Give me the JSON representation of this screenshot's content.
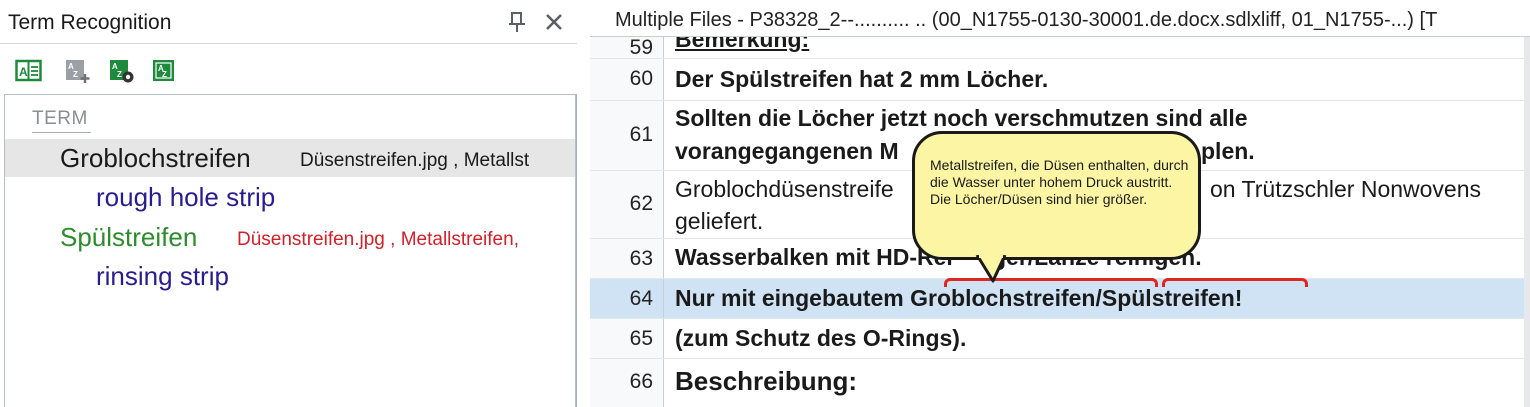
{
  "term_recognition": {
    "title": "Term Recognition",
    "column_header": "TERM",
    "toolbar": {
      "btn1_icon": "view-term-icon",
      "btn2_icon": "add-term-icon",
      "btn3_icon": "term-settings-icon",
      "btn4_icon": "termbase-search-icon"
    },
    "terms": [
      {
        "source": "Groblochstreifen",
        "source_color": "#1a1a1a",
        "files": "Düsenstreifen.jpg , Metallst",
        "files_color": "#1a1a1a",
        "target": "rough hole strip"
      },
      {
        "source": "Spülstreifen",
        "source_color": "#2e8b2e",
        "files": "Düsenstreifen.jpg , Metallstreifen,",
        "files_color": "#d0202a",
        "target": "rinsing strip"
      }
    ]
  },
  "editor": {
    "title": "Multiple Files - P38328_2--.......... .. (00_N1755-0130-30001.de.docx.sdlxliff, 01_N1755-...) [T",
    "segments": [
      {
        "num": "59",
        "text": "Bemerkung:",
        "bold": true
      },
      {
        "num": "60",
        "text": "Der Spülstreifen hat 2 mm Löcher.",
        "bold": true
      },
      {
        "num": "61",
        "line1": "Sollten die Löcher jetzt noch verschmutzen sind alle",
        "line2": "vorangegangenen M",
        "line2_end": "plen.",
        "bold": true
      },
      {
        "num": "62",
        "line1": "Groblochdüsenstreife",
        "line1_end": "on Trützschler Nonwovens",
        "line2": "geliefert.",
        "bold": false
      },
      {
        "num": "63",
        "text": "Wasserbalken mit HD-Rei",
        "text_end": "ger/Lanze reinigen.",
        "bold": true
      },
      {
        "num": "64",
        "text_a": "Nur mit eingebautem ",
        "text_b": "Groblochstreifen",
        "text_c": "/",
        "text_d": "Spülstreifen",
        "text_e": "!",
        "bold": true
      },
      {
        "num": "65",
        "text": "(zum Schutz des O-Rings).",
        "bold": true
      },
      {
        "num": "66",
        "text": "Beschreibung:",
        "bold": true
      }
    ],
    "tooltip": "Metallstreifen, die Düsen enthalten, durch die Wasser unter hohem Druck austritt. Die Löcher/Düsen sind hier größer."
  },
  "colors": {
    "selected_row": "#cfe3f5",
    "tooltip_bg": "#fbf5a4",
    "term_marker": "#e0271f",
    "target_term": "#2a1b8e"
  }
}
